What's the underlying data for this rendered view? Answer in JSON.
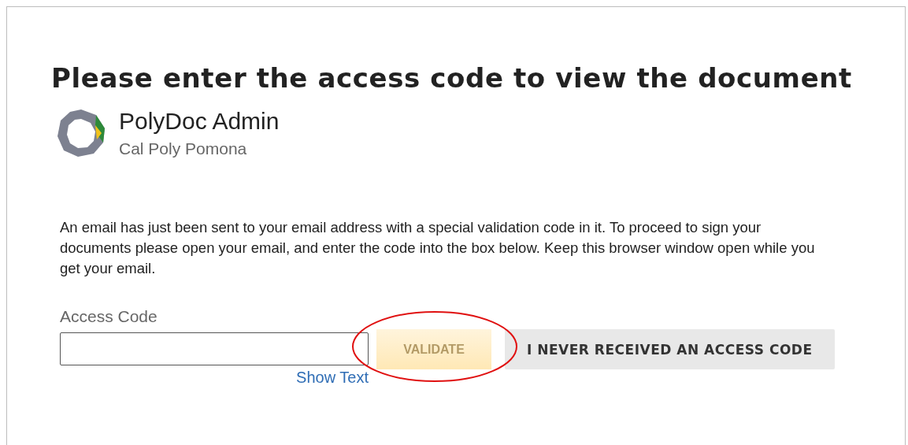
{
  "heading": "Please enter the access code to view the document",
  "sender": {
    "name": "PolyDoc Admin",
    "organization": "Cal Poly Pomona"
  },
  "message": "An email has just been sent to your email address with a special validation code in it. To proceed to sign your documents please open your email, and enter the code into the box below. Keep this browser window open while you get your email.",
  "access_code": {
    "label": "Access Code",
    "show_text_link": "Show Text"
  },
  "validate_button": {
    "label": "VALIDATE",
    "disabled": true,
    "circled": true
  },
  "no_code_button": {
    "label": "I NEVER RECEIVED AN ACCESS CODE"
  }
}
